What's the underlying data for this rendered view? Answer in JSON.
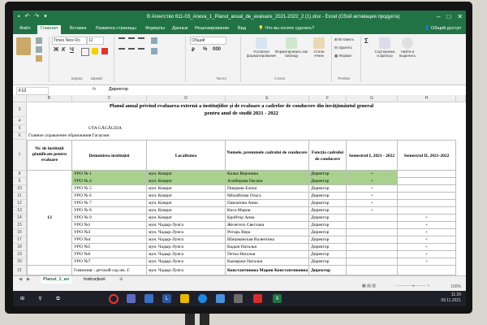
{
  "window": {
    "title": "В Агентство 611-03_Anexa_1_Planul_anual_de_evaluare_2021-2022_2 (1).xlsx - Excel (Сбой активации продукта)",
    "sign_in": "Общий доступ"
  },
  "ribbon_tabs": [
    "Файл",
    "Главная",
    "Вставка",
    "Разметка страницы",
    "Формулы",
    "Данные",
    "Рецензирование",
    "Вид"
  ],
  "tell_me": "Что вы хотите сделать?",
  "ribbon": {
    "font_name": "Times New Ro",
    "font_size": "12",
    "number_format": "Общий",
    "cond_format": "Условное форматирование",
    "format_table": "Форматировать как таблицу",
    "cell_styles": "Стили ячеек",
    "insert": "Вставить",
    "delete": "Удалить",
    "format": "Формат",
    "sort_filter": "Сортировка и фильтр",
    "find_select": "Найти и выделить",
    "groups": [
      "Буфер",
      "Шрифт",
      "Число",
      "Стили",
      "Ячейки"
    ]
  },
  "formula_bar": {
    "name_box": "F12",
    "fx": "fx",
    "value": "Директор"
  },
  "columns": [
    "B",
    "C",
    "D",
    "E",
    "F",
    "G",
    "H"
  ],
  "rows_numbers": [
    "3",
    "4",
    "5",
    "6",
    "7",
    "8",
    "9",
    "10",
    "11",
    "12",
    "13",
    "14",
    "15",
    "16",
    "17",
    "18",
    "19",
    "20",
    "21"
  ],
  "sheet": {
    "title_line1": "Planul anual privind evaluarea externă a instituțiilor și de evaluare a cadrelor de conducere din învățământul general",
    "title_line2": "pentru anul de studii 2021 - 2022",
    "region_ro": "UTA GĂGĂUZIA",
    "region_ru": "Главное управление образования Гагаузии",
    "headers": {
      "col_b": "Nr. de instituții planificate pentru evaluare",
      "col_c": "Denumirea instituției",
      "col_d": "Localitatea",
      "col_e": "Numele, prenumele cadrului de conducere",
      "col_f": "Funcția cadrului de conducere",
      "col_g": "Semestrul I, 2021 - 2022",
      "col_h": "Semestrul II, 2021-2022"
    },
    "count_value": "13",
    "rows": [
      {
        "c": "УРО № 1",
        "d": "мун. Комрат",
        "e": "Кальк Вероника",
        "f": "Директор",
        "g": "+",
        "h": ""
      },
      {
        "c": "УРО № 4",
        "d": "мун. Комрат",
        "e": "Алиберова Оксана",
        "f": "Директор",
        "g": "+",
        "h": ""
      },
      {
        "c": "УРО № 5",
        "d": "мун. Комрат",
        "e": "Пиерман Елена",
        "f": "Директор",
        "g": "+",
        "h": ""
      },
      {
        "c": "УРО № 6",
        "d": "мун. Комрат",
        "e": "Михайлова Ольга",
        "f": "Директор",
        "g": "+",
        "h": ""
      },
      {
        "c": "УРО № 7",
        "d": "мун. Комрат",
        "e": "Павлатова Анна",
        "f": "Директор",
        "g": "+",
        "h": ""
      },
      {
        "c": "УРО № 8",
        "d": "мун. Комрат",
        "e": "Киса Мария",
        "f": "Директор",
        "g": "+",
        "h": ""
      },
      {
        "c": "УРО № 9",
        "d": "мун. Комрат",
        "e": "Кройтор Анна",
        "f": "Директор",
        "g": "",
        "h": "+"
      },
      {
        "c": "УРО №1",
        "d": "мун. Чадыр-Лунга",
        "e": "Желегело Светлана",
        "f": "Директор",
        "g": "",
        "h": "+"
      },
      {
        "c": "УРО №3",
        "d": "мун. Чадыр-Лунга",
        "e": "Ротарь Вера",
        "f": "Директор",
        "g": "",
        "h": "+"
      },
      {
        "c": "УРО №4",
        "d": "мун. Чадыр-Лунга",
        "e": "Шишманская Валентина",
        "f": "Директор",
        "g": "",
        "h": "+"
      },
      {
        "c": "УРО №5",
        "d": "мун. Чадыр-Лунга",
        "e": "Кадын Наталья",
        "f": "Директор",
        "g": "",
        "h": "+"
      },
      {
        "c": "УРО №6",
        "d": "мун. Чадыр-Лунга",
        "e": "Петка Наталья",
        "f": "Директор",
        "g": "",
        "h": "+"
      },
      {
        "c": "УРО №7",
        "d": "мун. Чадыр-Лунга",
        "e": "Кымаржи Наталья",
        "f": "Директор",
        "g": "",
        "h": "+"
      },
      {
        "c": "Гимназия - детский сад им. Г.",
        "d": "мун. Чадыр-Лунга",
        "e": "Константинова Мария Константиновна",
        "f": "Директор",
        "g": "",
        "h": ""
      }
    ]
  },
  "sheet_tabs": [
    "Planul_1_an",
    "Instrucțiuni"
  ],
  "zoom": "100%",
  "clock": {
    "time": "11:26",
    "date": "09.11.2021"
  },
  "colors": {
    "excel_green": "#217346",
    "highlight_green": "#a9d18e"
  }
}
